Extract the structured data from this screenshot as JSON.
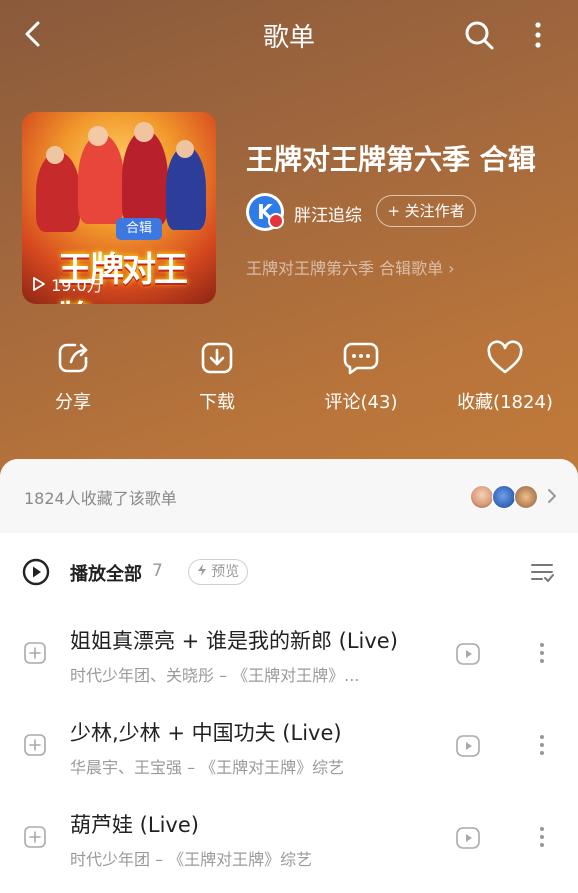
{
  "header": {
    "title": "歌单"
  },
  "playlist": {
    "title": "王牌对王牌第六季 合辑",
    "cover_tag": "合辑",
    "cover_logo": "王牌对王牌",
    "play_count": "19.0万",
    "author_name": "胖汪追综",
    "follow_label": "+ 关注作者",
    "subtitle": "王牌对王牌第六季 合辑歌单 ›"
  },
  "actions": [
    {
      "label": "分享",
      "icon": "share-icon"
    },
    {
      "label": "下载",
      "icon": "download-icon"
    },
    {
      "label": "评论(43)",
      "icon": "comment-icon"
    },
    {
      "label": "收藏(1824)",
      "icon": "heart-icon"
    }
  ],
  "collect": {
    "text": "1824人收藏了该歌单"
  },
  "play_all": {
    "label": "播放全部",
    "count": "7",
    "preview_label": "预览"
  },
  "songs": [
    {
      "name": "姐姐真漂亮 + 谁是我的新郎 (Live)",
      "meta": "时代少年团、关晓彤 – 《王牌对王牌》..."
    },
    {
      "name": "少林,少林 + 中国功夫 (Live)",
      "meta": "华晨宇、王宝强 – 《王牌对王牌》综艺"
    },
    {
      "name": "葫芦娃 (Live)",
      "meta": "时代少年团 – 《王牌对王牌》综艺"
    }
  ],
  "colors": {
    "hero_top": "#8a5a3c",
    "hero_bottom": "#c07a3a",
    "accent_blue": "#2f7be8"
  }
}
